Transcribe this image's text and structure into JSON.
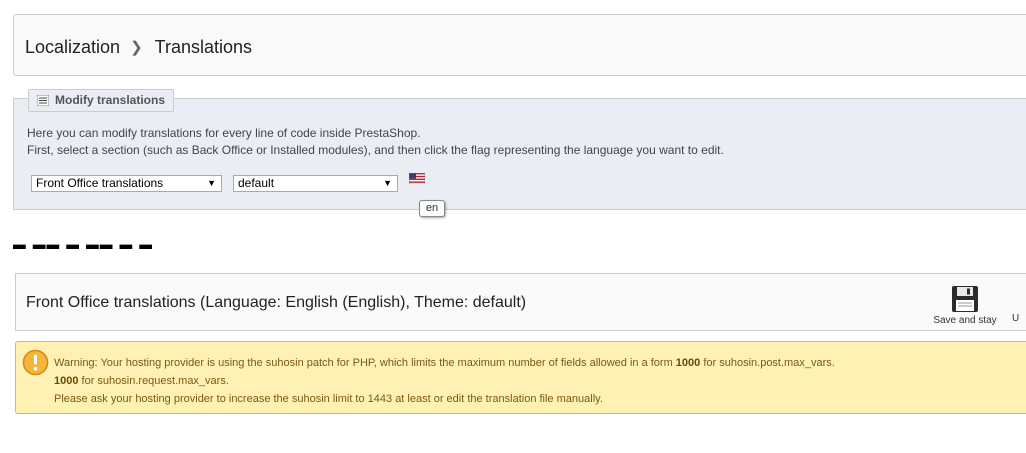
{
  "breadcrumb": {
    "section": "Localization",
    "page": "Translations"
  },
  "modify": {
    "legend": "Modify translations",
    "desc_line1": "Here you can modify translations for every line of code inside PrestaShop.",
    "desc_line2": "First, select a section (such as Back Office or Installed modules), and then click the flag representing the language you want to edit.",
    "type_select": "Front Office translations",
    "theme_select": "default",
    "flag_icon": "us-flag-icon",
    "flag_tooltip": "en"
  },
  "panel": {
    "title": "Front Office translations (Language: English (English), Theme: default)",
    "save_stay_label": "Save and stay",
    "cut_label": "U"
  },
  "warning": {
    "part1": "Warning: Your hosting provider is using the suhosin patch for PHP, which limits the maximum number of fields allowed in a form ",
    "post_limit": "1000",
    "part2": " for suhosin.post.max_vars.",
    "request_limit": "1000",
    "part3": " for suhosin.request.max_vars.",
    "line3": "Please ask your hosting provider to increase the suhosin limit to 1443 at least or edit the translation file manually."
  },
  "colors": {
    "fieldset_bg": "#ebedf4",
    "warning_bg": "#fff0b3",
    "warning_text": "#7a5a12"
  }
}
